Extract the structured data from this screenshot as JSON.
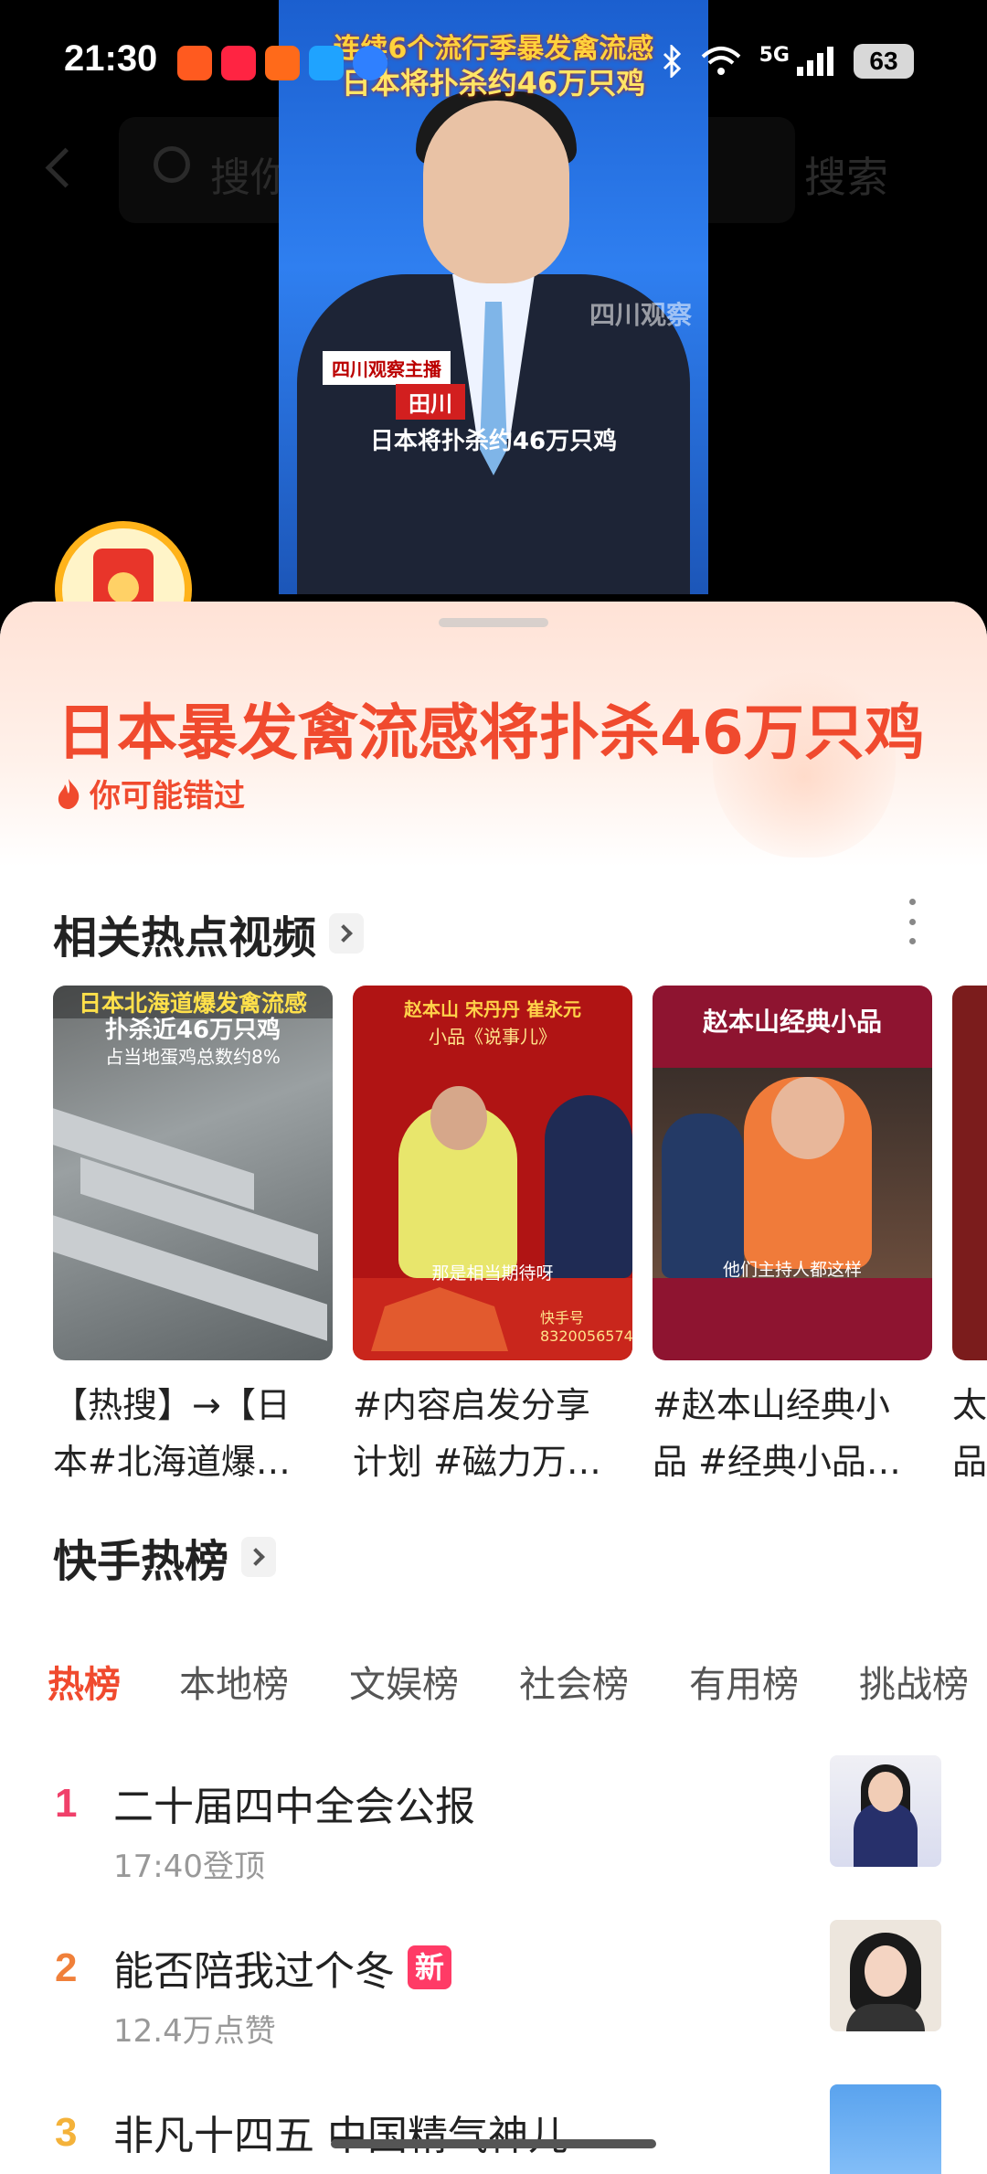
{
  "status_bar": {
    "time": "21:30",
    "network": "5G",
    "battery": "63",
    "app_icons": [
      "send-app-icon",
      "heart-app-icon",
      "grid-app-icon",
      "broadcast-app-icon",
      "compass-app-icon"
    ],
    "icons": [
      "bluetooth-icon",
      "wifi-icon",
      "signal-icon"
    ]
  },
  "background": {
    "search_placeholder": "搜你想看的",
    "search_button": "搜索"
  },
  "video": {
    "headline_1": "连续6个流行季暴发禽流感",
    "headline_2": "日本将扑杀约46万只鸡",
    "badge": "四川观察主播",
    "anchor_name": "田川",
    "subtitle": "日本将扑杀约46万只鸡",
    "logo": "四川观察"
  },
  "sheet": {
    "title": "日本暴发禽流感将扑杀46万只鸡",
    "missed_label": "你可能错过",
    "related_section_title": "相关热点视频",
    "related_videos": [
      {
        "thumb_line1": "日本北海道爆发禽流感",
        "thumb_line2": "扑杀近46万只鸡",
        "thumb_line3": "占当地蛋鸡总数约8%",
        "caption_line1": "【热搜】→【日",
        "caption_line2": "本#北海道爆…"
      },
      {
        "thumb_top": "赵本山 宋丹丹 崔永元",
        "thumb_mid": "小品《说事儿》",
        "thumb_sub": "那是相当期待呀",
        "thumb_id": "快手号 8320056574",
        "caption_line1": "#内容启发分享",
        "caption_line2": "计划 #磁力万…"
      },
      {
        "thumb_head": "赵本山经典小品",
        "thumb_sub": "他们主持人都这样",
        "caption_line1": "#赵本山经典小",
        "caption_line2": "品 #经典小品…"
      },
      {
        "caption_line1": "太",
        "caption_line2": "品"
      }
    ],
    "hot_section_title": "快手热榜",
    "tabs": [
      "热榜",
      "本地榜",
      "文娱榜",
      "社会榜",
      "有用榜",
      "挑战榜"
    ],
    "active_tab": "热榜",
    "hot_list": [
      {
        "rank": "1",
        "title": "二十届四中全会公报",
        "meta": "17:40登顶",
        "badge": "",
        "rank_color": "#f0406a"
      },
      {
        "rank": "2",
        "title": "能否陪我过个冬",
        "meta": "12.4万点赞",
        "badge": "新",
        "rank_color": "#f0803a"
      },
      {
        "rank": "3",
        "title": "非凡十四五 中国精气神儿",
        "meta": "",
        "badge": "",
        "rank_color": "#f4b23a"
      }
    ]
  },
  "colors": {
    "accent": "#f04a2e",
    "new_badge": "#ff3b66"
  }
}
